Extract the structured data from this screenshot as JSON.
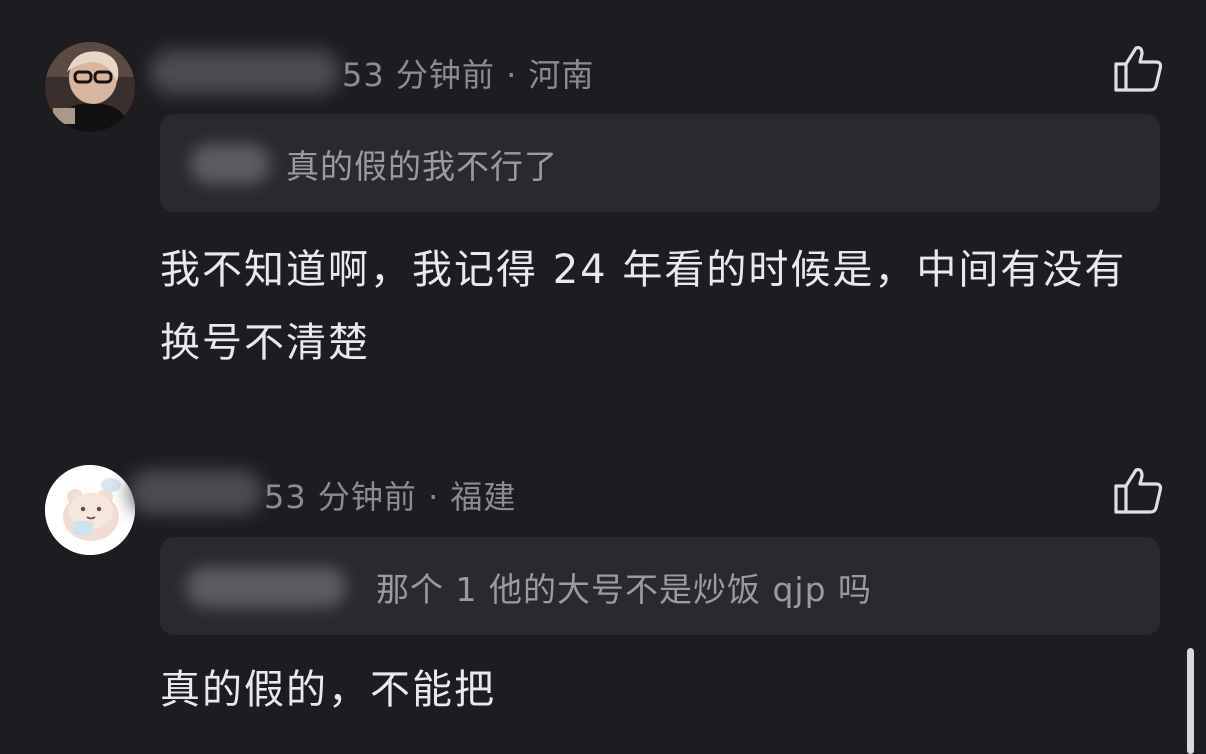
{
  "comments": [
    {
      "meta": "53 分钟前 · 河南",
      "quote": "真的假的我不行了",
      "content": "我不知道啊，我记得 24 年看的时候是，中间有没有换号不清楚",
      "like_icon": "thumbs-up-outline-icon"
    },
    {
      "meta": "53 分钟前 · 福建",
      "quote": "那个 1 他的大号不是炒饭 qjp 吗",
      "content": "真的假的，不能把",
      "like_icon": "thumbs-up-outline-icon"
    }
  ],
  "colors": {
    "background": "#1d1c21",
    "quote_background": "#2a292f",
    "meta_text": "#8c8b92",
    "content_text": "#e9e8ed"
  }
}
